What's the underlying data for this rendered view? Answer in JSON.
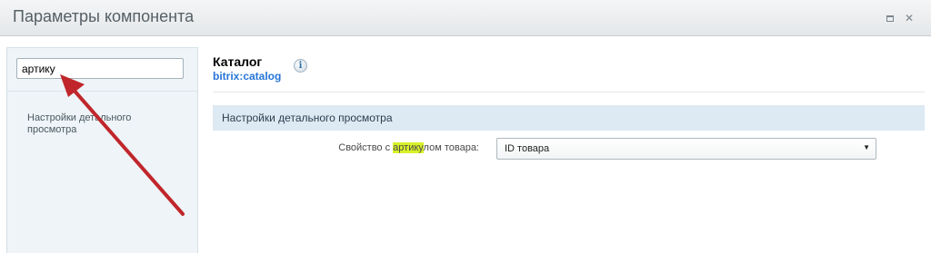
{
  "dialog": {
    "title": "Параметры компонента",
    "maximize_glyph": "",
    "close_glyph": "✕"
  },
  "sidebar": {
    "search": {
      "value": "артику"
    },
    "items": [
      {
        "label": "Настройки детального просмотра"
      }
    ]
  },
  "component": {
    "name": "Каталог",
    "id": "bitrix:catalog",
    "info_glyph": "i"
  },
  "section": {
    "title": "Настройки детального просмотра"
  },
  "field": {
    "label_before": "Свойство с ",
    "label_highlight": "артику",
    "label_after": "лом товара:",
    "selected_value": "ID товара",
    "arrow_glyph": "▼"
  },
  "colors": {
    "highlight": "#d8f22a",
    "annotation_arrow": "#c0262b",
    "link": "#2675d7",
    "section_bar": "#dde9f3"
  }
}
